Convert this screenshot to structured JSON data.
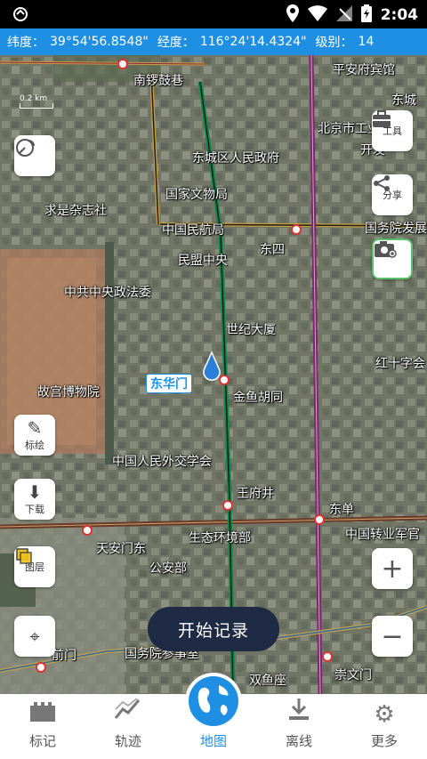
{
  "status_bar": {
    "time": "2:04"
  },
  "coords": {
    "lat_label": "纬度：",
    "lat": "39°54'56.8548\"",
    "lng_label": "经度：",
    "lng": "116°24'14.4324\"",
    "level_label": "级别：",
    "level": "14"
  },
  "map": {
    "scale": "0.2 km",
    "labels": [
      {
        "text": "平安府宾馆"
      },
      {
        "text": "南锣鼓巷"
      },
      {
        "text": "东城"
      },
      {
        "text": "北京市工业"
      },
      {
        "text": "开发"
      },
      {
        "text": "东城区人民政府"
      },
      {
        "text": "国家文物局"
      },
      {
        "text": "求是杂志社"
      },
      {
        "text": "中国民航局"
      },
      {
        "text": "国务院发展"
      },
      {
        "text": "东四"
      },
      {
        "text": "民盟中央"
      },
      {
        "text": "中共中央政法委"
      },
      {
        "text": "世纪大厦"
      },
      {
        "text": "红十字会"
      },
      {
        "text": "东华门"
      },
      {
        "text": "故宫博物院"
      },
      {
        "text": "金鱼胡同"
      },
      {
        "text": "中国人民外交学会"
      },
      {
        "text": "王府井"
      },
      {
        "text": "东单"
      },
      {
        "text": "天安门东"
      },
      {
        "text": "生态环境部"
      },
      {
        "text": "中国转业军官"
      },
      {
        "text": "公安部"
      },
      {
        "text": "前门"
      },
      {
        "text": "国务院参事室"
      },
      {
        "text": "双鱼座"
      },
      {
        "text": "崇文门"
      }
    ]
  },
  "tools": {
    "tools_label": "工具",
    "share_label": "分享",
    "mark_label": "标绘",
    "download_label": "下载",
    "layer_label": "图层",
    "zoom_in": "+",
    "zoom_out": "−"
  },
  "record_button": "开始记录",
  "nav": [
    {
      "label": "标记"
    },
    {
      "label": "轨迹"
    },
    {
      "label": "地图"
    },
    {
      "label": "离线"
    },
    {
      "label": "更多"
    }
  ],
  "colors": {
    "accent": "#1f8fe3",
    "record_bg": "#1f2a44"
  }
}
